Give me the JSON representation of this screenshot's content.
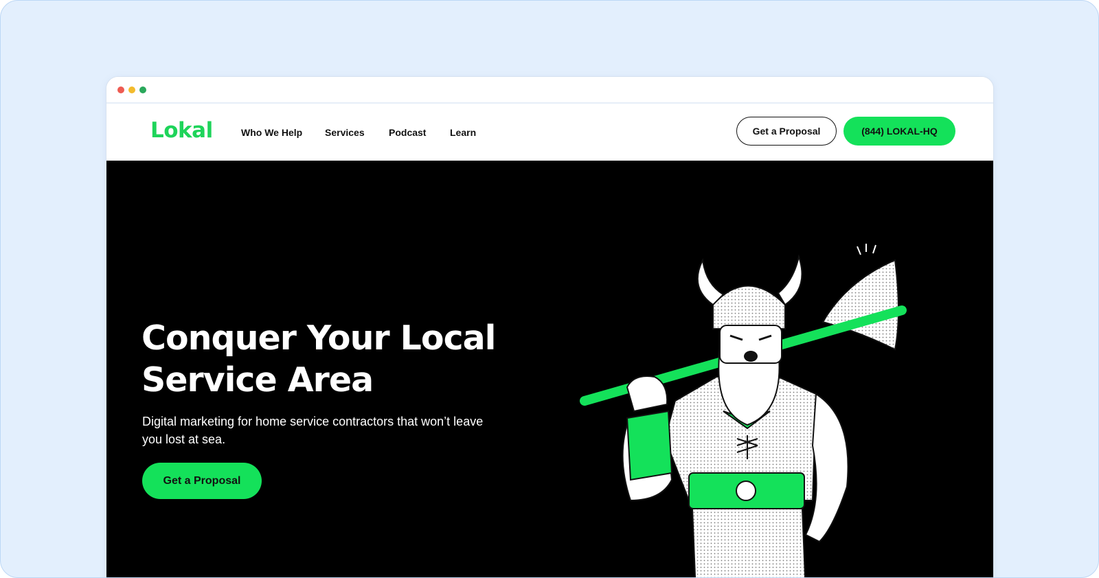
{
  "brand": {
    "logo": "Lokal",
    "accent": "#14e15a"
  },
  "nav": {
    "items": [
      {
        "label": "Who We Help"
      },
      {
        "label": "Services"
      },
      {
        "label": "Podcast"
      },
      {
        "label": "Learn"
      }
    ],
    "proposal_button": "Get a Proposal",
    "phone_button": "(844) LOKAL-HQ"
  },
  "hero": {
    "title_line1": "Conquer Your Local",
    "title_line2": "Service Area",
    "subtitle": "Digital marketing for home service contractors that won’t leave you lost at sea.",
    "cta": "Get a Proposal",
    "illustration": "viking-illustration"
  },
  "colors": {
    "background": "#e3effd",
    "hero_bg": "#000000",
    "text_dark": "#111111"
  }
}
